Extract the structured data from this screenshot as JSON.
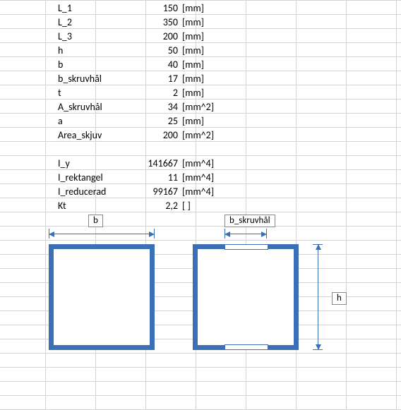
{
  "rows": [
    {
      "name": "L_1",
      "value": "150",
      "unit": "[mm]"
    },
    {
      "name": "L_2",
      "value": "350",
      "unit": "[mm]"
    },
    {
      "name": "L_3",
      "value": "200",
      "unit": "[mm]"
    },
    {
      "name": "h",
      "value": "50",
      "unit": "[mm]"
    },
    {
      "name": "b",
      "value": "40",
      "unit": "[mm]"
    },
    {
      "name": "b_skruvhål",
      "value": "17",
      "unit": "[mm]"
    },
    {
      "name": "t",
      "value": "2",
      "unit": "[mm]"
    },
    {
      "name": "A_skruvhål",
      "value": "34",
      "unit": "[mm^2]"
    },
    {
      "name": "a",
      "value": "25",
      "unit": "[mm]"
    },
    {
      "name": "Area_skjuv",
      "value": "200",
      "unit": "[mm^2]"
    }
  ],
  "rows2": [
    {
      "name": "I_y",
      "value": "141667",
      "unit": "[mm^4]"
    },
    {
      "name": "I_rektangel",
      "value": "11",
      "unit": "[mm^4]"
    },
    {
      "name": "I_reducerad",
      "value": "99167",
      "unit": "[mm^4]"
    },
    {
      "name": "Kt",
      "value": "2,2",
      "unit": "[ ]"
    }
  ],
  "labels": {
    "b": "b",
    "b_skruvhal": "b_skruvhål",
    "h": "h"
  }
}
